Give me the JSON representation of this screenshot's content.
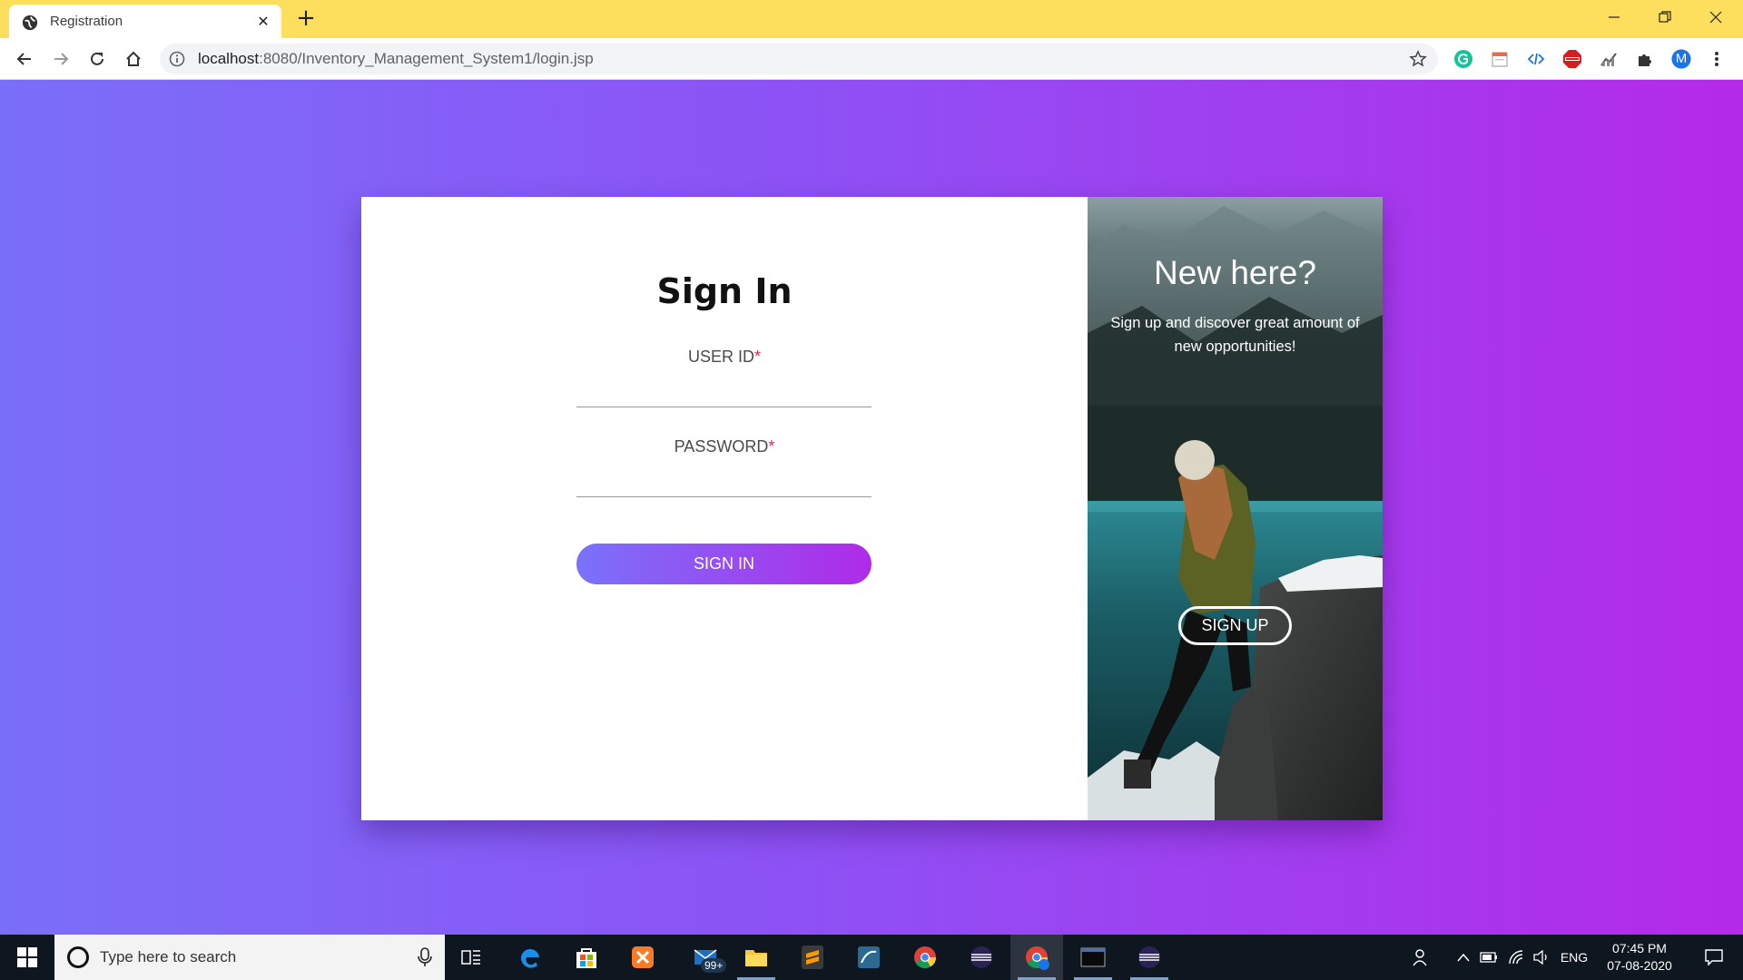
{
  "browser": {
    "tab_title": "Registration",
    "url_host": "localhost",
    "url_path": ":8080/Inventory_Management_System1/login.jsp",
    "extensions": [
      "grammarly-icon",
      "calendar-icon",
      "code-icon",
      "adblock-icon",
      "chart-icon",
      "puzzle-icon"
    ],
    "profile_initial": "M",
    "theme_color": "#fedf5d"
  },
  "signin": {
    "title": "Sign In",
    "user_label": "USER ID",
    "password_label": "PASSWORD",
    "required_mark": "*",
    "button_label": "SIGN IN"
  },
  "promo": {
    "title": "New here?",
    "text": "Sign up and discover great amount of new opportunities!",
    "button_label": "SIGN UP"
  },
  "taskbar": {
    "search_placeholder": "Type here to search",
    "mail_badge": "99+",
    "language": "ENG",
    "time": "07:45 PM",
    "date": "07-08-2020"
  },
  "colors": {
    "gradient_start": "#7a6ff9",
    "gradient_end": "#b42ae9",
    "required": "#e0245e"
  }
}
